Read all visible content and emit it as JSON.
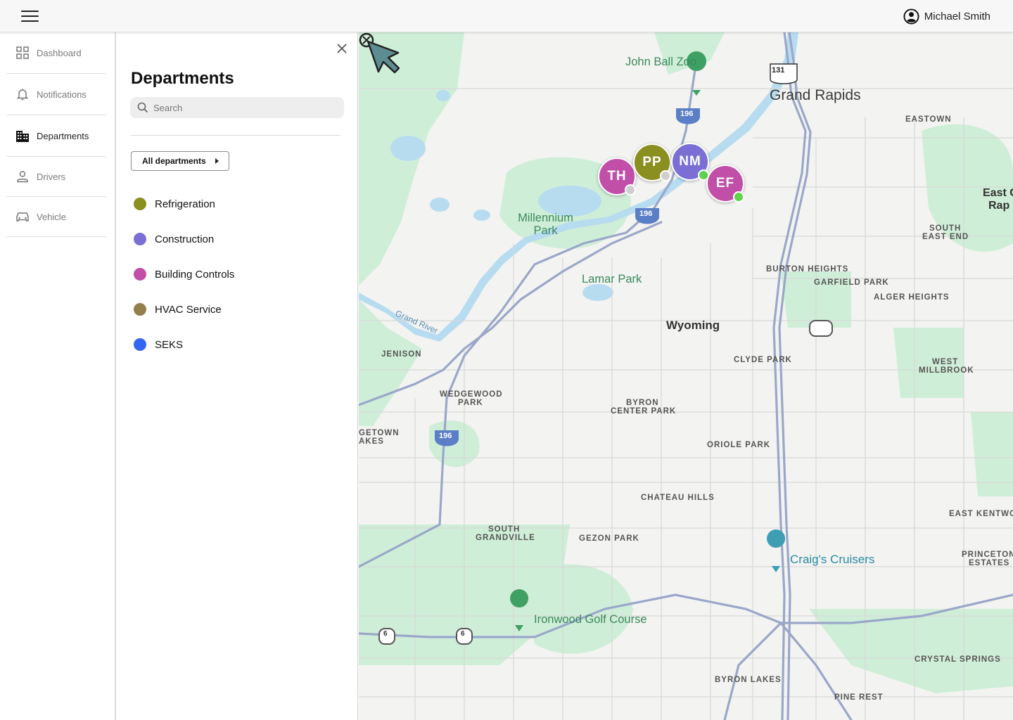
{
  "header": {
    "user_name": "Michael Smith",
    "icons": {
      "menu": "hamburger-menu-icon",
      "user": "account-circle-icon"
    }
  },
  "nav": {
    "items": [
      {
        "label": "Dashboard",
        "icon": "grid-icon",
        "active": false
      },
      {
        "label": "Notifications",
        "icon": "bell-icon",
        "active": false
      },
      {
        "label": "Departments",
        "icon": "building-icon",
        "active": true
      },
      {
        "label": "Drivers",
        "icon": "person-icon",
        "active": false
      },
      {
        "label": "Vehicle",
        "icon": "car-icon",
        "active": false
      }
    ]
  },
  "panel": {
    "title": "Departments",
    "search_placeholder": "Search",
    "all_button": "All departments",
    "departments": [
      {
        "name": "Refrigeration",
        "color": "#8a8f1f"
      },
      {
        "name": "Construction",
        "color": "#7b6fd6"
      },
      {
        "name": "Building Controls",
        "color": "#c14fa8"
      },
      {
        "name": "HVAC Service",
        "color": "#957f4d"
      },
      {
        "name": "SEKS",
        "color": "#3466f0"
      }
    ]
  },
  "map": {
    "labels": {
      "city": "Grand Rapids",
      "wyoming": "Wyoming",
      "zoo": "John Ball Zoo",
      "millennium": "Millennium Park",
      "lamar": "Lamar Park",
      "grand_river": "Grand River",
      "eastown": "EASTOWN",
      "east_grand_rapids_1": "East G",
      "east_grand_rapids_2": "Rap",
      "south_east_end_1": "SOUTH",
      "south_east_end_2": "EAST END",
      "burton_heights": "BURTON HEIGHTS",
      "garfield_park": "GARFIELD PARK",
      "alger_heights": "ALGER HEIGHTS",
      "jenison": "JENISON",
      "clyde_park": "CLYDE PARK",
      "west_millbrook_1": "WEST",
      "west_millbrook_2": "MILLBROOK",
      "wedgewood_1": "WEDGEWOOD",
      "wedgewood_2": "PARK",
      "byron_center_park_1": "BYRON",
      "byron_center_park_2": "CENTER PARK",
      "georgetown_1": "GETOWN",
      "georgetown_2": "AKES",
      "oriole_park": "ORIOLE PARK",
      "chateau_hills": "CHATEAU HILLS",
      "south_grandville_1": "SOUTH",
      "south_grandville_2": "GRANDVILLE",
      "gezon_park": "GEZON PARK",
      "east_kentwood": "EAST KENTWO",
      "princeton_1": "PRINCETON",
      "princeton_2": "ESTATES",
      "craigs": "Craig's Cruisers",
      "ironwood": "Ironwood Golf Course",
      "crystal_springs": "CRYSTAL SPRINGS",
      "byron_lakes": "BYRON LAKES",
      "pine_rest": "PINE REST",
      "shield_131": "131",
      "shield_196_a": "196",
      "shield_196_b": "196",
      "shield_196_c": "196",
      "shield_6_a": "6",
      "shield_6_b": "6"
    },
    "markers": [
      {
        "initials": "TH",
        "color": "#c14fa8",
        "status": "#cfcfcf"
      },
      {
        "initials": "PP",
        "color": "#8a8f1f",
        "status": "#cfcfcf"
      },
      {
        "initials": "NM",
        "color": "#7b6fd6",
        "status": "#5fd34a"
      },
      {
        "initials": "EF",
        "color": "#c14fa8",
        "status": "#5fd34a"
      }
    ]
  }
}
